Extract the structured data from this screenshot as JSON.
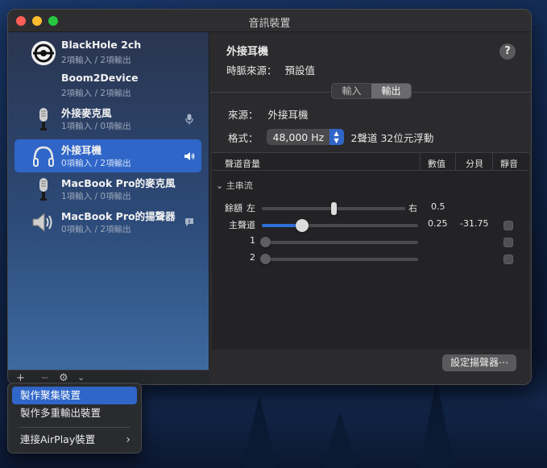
{
  "window": {
    "title": "音訊裝置"
  },
  "devices": [
    {
      "name": "BlackHole 2ch",
      "sub": "2項輸入 / 2項輸出",
      "icon": "blackhole-icon",
      "badge": ""
    },
    {
      "name": "Boom2Device",
      "sub": "2項輸入 / 2項輸出",
      "icon": "",
      "badge": ""
    },
    {
      "name": "外接麥克風",
      "sub": "1項輸入 / 0項輸出",
      "icon": "microphone-icon",
      "badge": "microphone-icon"
    },
    {
      "name": "外接耳機",
      "sub": "0項輸入 / 2項輸出",
      "icon": "headphones-icon",
      "badge": "speaker-icon",
      "selected": true
    },
    {
      "name": "MacBook Pro的麥克風",
      "sub": "1項輸入 / 0項輸出",
      "icon": "microphone-icon",
      "badge": ""
    },
    {
      "name": "MacBook Pro的揚聲器",
      "sub": "0項輸入 / 2項輸出",
      "icon": "speaker-icon",
      "badge": "alert-icon"
    }
  ],
  "sidebar_toolbar": {
    "add": "+",
    "remove": "−",
    "gear": "⚙",
    "chevron": "⌄"
  },
  "detail": {
    "title": "外接耳機",
    "clock_label": "時脈來源：",
    "clock_value": "預設值",
    "help": "?",
    "tabs": [
      "輸入",
      "輸出"
    ],
    "active_tab": "輸出",
    "source_label": "來源：",
    "source_value": "外接耳機",
    "format_label": "格式：",
    "format_value": "48,000 Hz",
    "format_desc": "2聲道 32位元浮動",
    "table": {
      "headers": [
        "聲道音量",
        "數值",
        "分貝",
        "靜音"
      ],
      "group": "主串流",
      "rows": [
        {
          "label": "餘額",
          "left": "左",
          "right": "右",
          "value": "0.5",
          "db": "",
          "level": 0.5,
          "mute": false
        },
        {
          "label": "主聲道",
          "value": "0.25",
          "db": "-31.75",
          "level": 0.25,
          "mute": false
        },
        {
          "label": "1",
          "value": "",
          "db": "",
          "level": 0,
          "mute": false
        },
        {
          "label": "2",
          "value": "",
          "db": "",
          "level": 0,
          "mute": false
        }
      ]
    },
    "configure_button": "設定揚聲器⋯"
  },
  "menu": {
    "items": [
      "製作聚集裝置",
      "製作多重輸出裝置",
      "連接AirPlay裝置"
    ],
    "highlighted": 0,
    "submenu_chevron": "›"
  },
  "colors": {
    "accent": "#2f66c8",
    "window_bg": "#2b2b2d"
  }
}
